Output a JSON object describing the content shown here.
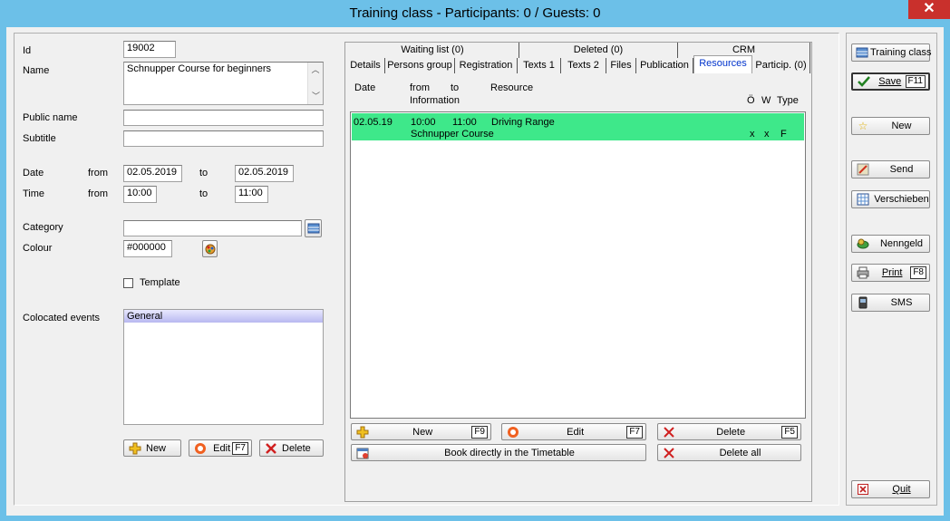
{
  "window": {
    "title": "Training class - Participants: 0 / Guests: 0",
    "close": "✕"
  },
  "form": {
    "id_label": "Id",
    "id_value": "19002",
    "name_label": "Name",
    "name_value": "Schnupper Course for beginners",
    "public_name_label": "Public name",
    "public_name_value": "",
    "subtitle_label": "Subtitle",
    "subtitle_value": "",
    "date_label": "Date",
    "date_from_label": "from",
    "date_from": "02.05.2019",
    "date_to_label": "to",
    "date_to": "02.05.2019",
    "time_label": "Time",
    "time_from_label": "from",
    "time_from": "10:00",
    "time_to_label": "to",
    "time_to": "11:00",
    "category_label": "Category",
    "category_value": "",
    "colour_label": "Colour",
    "colour_value": "#000000",
    "template_label": "Template",
    "colocated_label": "Colocated events",
    "colocated_items": [
      "General"
    ],
    "new_label": "New",
    "edit_label": "Edit",
    "edit_key": "F7",
    "delete_label": "Delete"
  },
  "tabs": {
    "row1": [
      "Waiting list (0)",
      "Deleted (0)",
      "CRM"
    ],
    "row2": [
      "Details",
      "Persons group",
      "Registration",
      "Texts 1",
      "Texts 2",
      "Files",
      "Publication",
      "Resources",
      "Particip. (0)"
    ],
    "active": "Resources"
  },
  "resources": {
    "headers": {
      "date": "Date",
      "from": "from",
      "to": "to",
      "resource": "Resource",
      "information": "Information",
      "o": "Ö",
      "w": "W",
      "type": "Type"
    },
    "rows": [
      {
        "date": "02.05.19",
        "from": "10:00",
        "to": "11:00",
        "resource": "Driving Range",
        "information": "Schnupper Course",
        "o": "x",
        "w": "x",
        "type": "F"
      }
    ],
    "new_label": "New",
    "new_key": "F9",
    "edit_label": "Edit",
    "edit_key": "F7",
    "delete_label": "Delete",
    "delete_key": "F5",
    "book_label": "Book directly in the Timetable",
    "delete_all_label": "Delete all"
  },
  "sidebar": {
    "training_class": "Training class",
    "save": "Save",
    "save_key": "F11",
    "new": "New",
    "send": "Send",
    "verschieben": "Verschieben",
    "nenngeld": "Nenngeld",
    "print": "Print",
    "print_key": "F8",
    "sms": "SMS",
    "quit": "Quit"
  },
  "colors": {
    "highlight_row": "#3ee88a",
    "window_frame": "#6cc0e8",
    "selected_list": "#c8c8f0"
  }
}
